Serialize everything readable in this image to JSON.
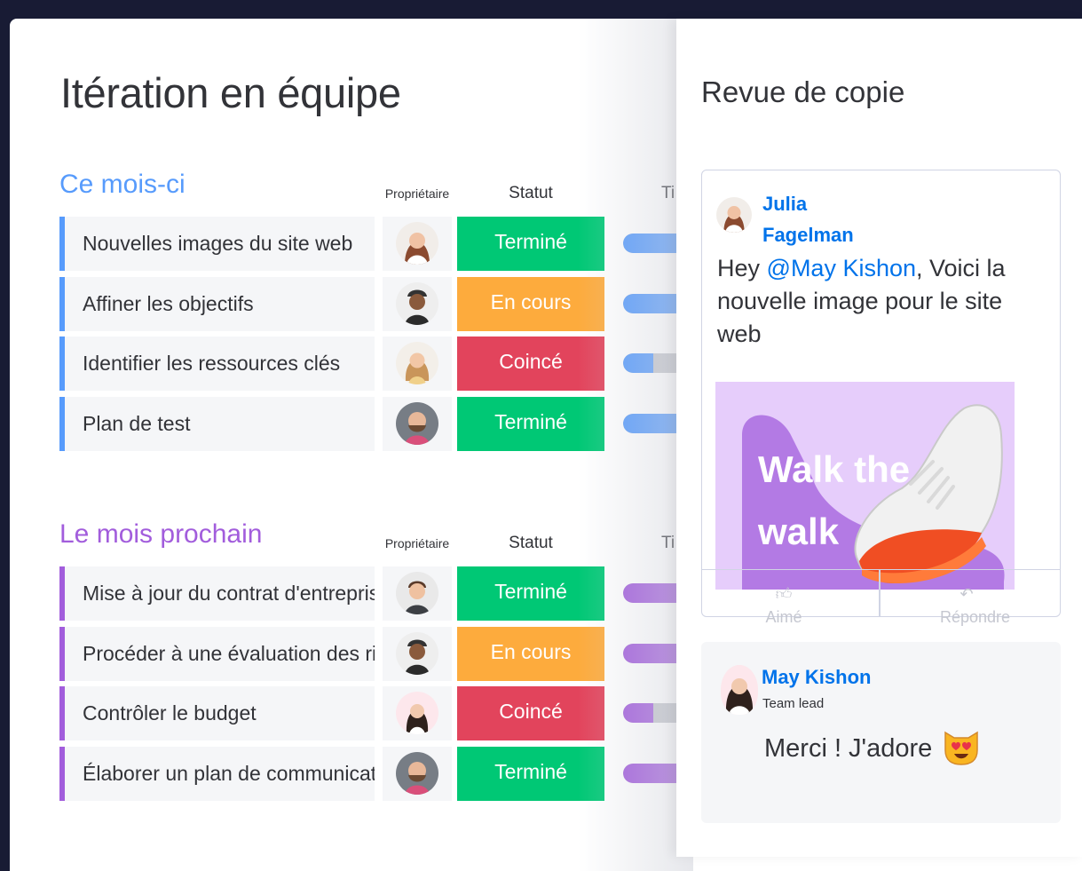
{
  "board": {
    "title": "Itération en équipe",
    "columns": {
      "owner": "Propriétaire",
      "status": "Statut",
      "timeline": "Ti"
    }
  },
  "groups": [
    {
      "title": "Ce mois-ci",
      "color": "#579bfc",
      "rows": [
        {
          "name": "Nouvelles images du site web",
          "status": "Terminé",
          "status_color": "#00c875",
          "timeline_progress": 1.0
        },
        {
          "name": "Affiner les objectifs",
          "status": "En cours",
          "status_color": "#fdab3d",
          "timeline_progress": 1.0
        },
        {
          "name": "Identifier les ressources clés",
          "status": "Coincé",
          "status_color": "#e2445c",
          "timeline_progress": 0.25
        },
        {
          "name": "Plan de test",
          "status": "Terminé",
          "status_color": "#00c875",
          "timeline_progress": 1.0
        }
      ]
    },
    {
      "title": "Le mois prochain",
      "color": "#a25ddc",
      "rows": [
        {
          "name": "Mise à jour du contrat d'entreprise",
          "status": "Terminé",
          "status_color": "#00c875",
          "timeline_progress": 1.0
        },
        {
          "name": "Procéder à une évaluation des risques",
          "status": "En cours",
          "status_color": "#fdab3d",
          "timeline_progress": 1.0
        },
        {
          "name": "Contrôler le budget",
          "status": "Coincé",
          "status_color": "#e2445c",
          "timeline_progress": 0.25
        },
        {
          "name": "Élaborer un plan de communication",
          "status": "Terminé",
          "status_color": "#00c875",
          "timeline_progress": 1.0
        }
      ]
    }
  ],
  "panel": {
    "title": "Revue de copie",
    "post": {
      "author": "Julia Fagelman",
      "body_before": "Hey ",
      "mention": "@May Kishon",
      "body_after": ", Voici la nouvelle image pour le site web",
      "image_text": "Walk the walk",
      "like_label": "Aimé",
      "reply_label": "Répondre"
    },
    "reply": {
      "author": "May Kishon",
      "role": "Team lead",
      "text": "Merci ! J'adore",
      "emoji_icon": "heart-eyes-cat-icon"
    }
  }
}
